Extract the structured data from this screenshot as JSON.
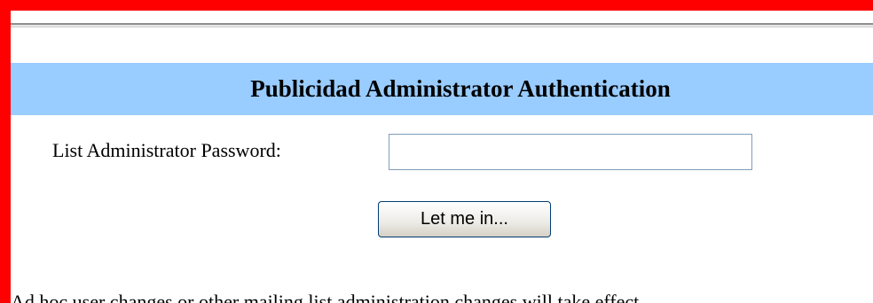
{
  "auth": {
    "title": "Publicidad Administrator Authentication",
    "password_label": "List Administrator Password:",
    "password_value": "",
    "password_placeholder": "",
    "submit_label": "Let me in..."
  },
  "notice": {
    "text": "Ad hoc user changes or other mailing list administration changes will take effect ..."
  },
  "colors": {
    "frame": "#ff0000",
    "header_band": "#99ccff"
  }
}
